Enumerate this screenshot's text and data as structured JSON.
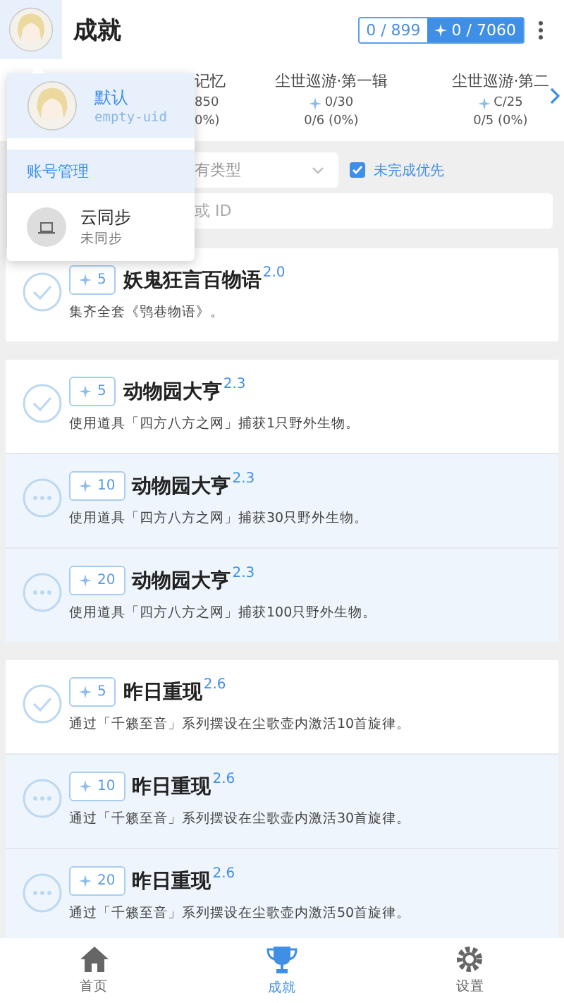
{
  "header": {
    "title": "成就",
    "count": "0 / 899",
    "points": "0 / 7060"
  },
  "categories": [
    {
      "label": "记忆",
      "count": "850",
      "progress": "0%)"
    },
    {
      "label": "尘世巡游·第一辑",
      "count": "0/30",
      "progress": "0/6 (0%)"
    },
    {
      "label": "尘世巡游·第二",
      "count": "C/25",
      "progress": "0/5 (0%)"
    }
  ],
  "filter": {
    "type": "有类型",
    "prioritize_unfinished": {
      "label": "未完成优先",
      "checked": true
    },
    "search": {
      "placeholder": "或 ID"
    }
  },
  "groups": [
    {
      "items": [
        {
          "reward": "5",
          "title": "妖鬼狂言百物语",
          "version": "2.0",
          "description": "集齐全套《鸮巷物语》。",
          "completed": true
        }
      ]
    },
    {
      "items": [
        {
          "reward": "5",
          "title": "动物园大亨",
          "version": "2.3",
          "description": "使用道具「四方八方之网」捕获1只野外生物。",
          "completed": true
        },
        {
          "reward": "10",
          "title": "动物园大亨",
          "version": "2.3",
          "description": "使用道具「四方八方之网」捕获30只野外生物。",
          "completed": false
        },
        {
          "reward": "20",
          "title": "动物园大亨",
          "version": "2.3",
          "description": "使用道具「四方八方之网」捕获100只野外生物。",
          "completed": false
        }
      ]
    },
    {
      "items": [
        {
          "reward": "5",
          "title": "昨日重现",
          "version": "2.6",
          "description": "通过「千籁至音」系列摆设在尘歌壶内激活10首旋律。",
          "completed": true
        },
        {
          "reward": "10",
          "title": "昨日重现",
          "version": "2.6",
          "description": "通过「千籁至音」系列摆设在尘歌壶内激活30首旋律。",
          "completed": false
        },
        {
          "reward": "20",
          "title": "昨日重现",
          "version": "2.6",
          "description": "通过「千籁至音」系列摆设在尘歌壶内激活50首旋律。",
          "completed": false
        }
      ]
    }
  ],
  "account_menu": {
    "accounts": [
      {
        "name": "默认",
        "uid": "empty-uid",
        "selected": true
      }
    ],
    "manage": "账号管理",
    "sync": {
      "title": "云同步",
      "status": "未同步"
    }
  },
  "bottom_nav": [
    {
      "label": "首页",
      "selected": false
    },
    {
      "label": "成就",
      "selected": true
    },
    {
      "label": "设置",
      "selected": false
    }
  ]
}
